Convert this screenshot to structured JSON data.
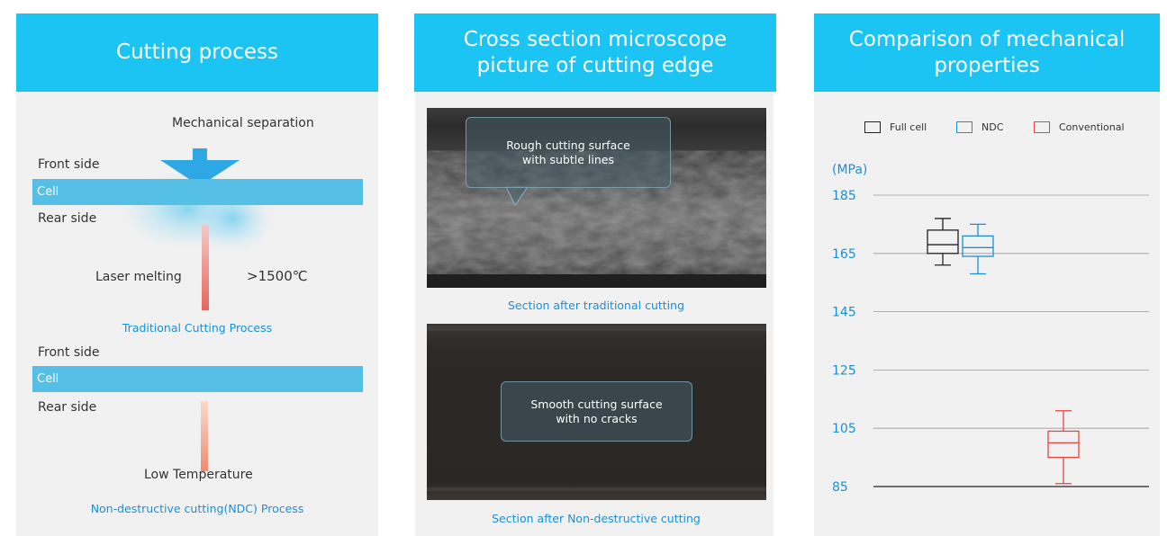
{
  "panels": {
    "cutting": {
      "title": "Cutting process",
      "traditional": {
        "mechanical_label": "Mechanical separation",
        "front_label": "Front side",
        "cell_label": "Cell",
        "rear_label": "Rear side",
        "laser_label": "Laser melting",
        "temp_label": ">1500℃",
        "caption": "Traditional Cutting Process"
      },
      "ndc": {
        "front_label": "Front side",
        "cell_label": "Cell",
        "rear_label": "Rear side",
        "temp_label": "Low Temperature",
        "caption": "Non-destructive cutting(NDC) Process"
      }
    },
    "microscope": {
      "title_line1": "Cross section microscope",
      "title_line2": "picture of cutting edge",
      "top_bubble_line1": "Rough cutting surface",
      "top_bubble_line2": "with subtle lines",
      "top_caption": "Section after traditional cutting",
      "bottom_bubble_line1": "Smooth cutting surface",
      "bottom_bubble_line2": "with no cracks",
      "bottom_caption": "Section after Non-destructive cutting"
    },
    "comparison": {
      "title_line1": "Comparison of mechanical",
      "title_line2": "properties"
    }
  },
  "colors": {
    "header": "#1cc4f3",
    "cell_bar": "#56bfe6",
    "full_cell": "#222222",
    "ndc": "#1a8fd6",
    "conventional": "#e8453c"
  },
  "chart_data": {
    "type": "box",
    "ylabel": "(MPa)",
    "ylim": [
      85,
      185
    ],
    "yticks": [
      185,
      165,
      145,
      125,
      105,
      85
    ],
    "grid": true,
    "legend_position": "top",
    "series": [
      {
        "name": "Full cell",
        "color": "#222222",
        "min": 161,
        "q1": 165,
        "median": 168,
        "q3": 173,
        "max": 177
      },
      {
        "name": "NDC",
        "color": "#1a8fd6",
        "min": 158,
        "q1": 164,
        "median": 167,
        "q3": 171,
        "max": 175
      },
      {
        "name": "Conventional",
        "color": "#e8453c",
        "min": 86,
        "q1": 95,
        "median": 100,
        "q3": 104,
        "max": 111
      }
    ]
  }
}
